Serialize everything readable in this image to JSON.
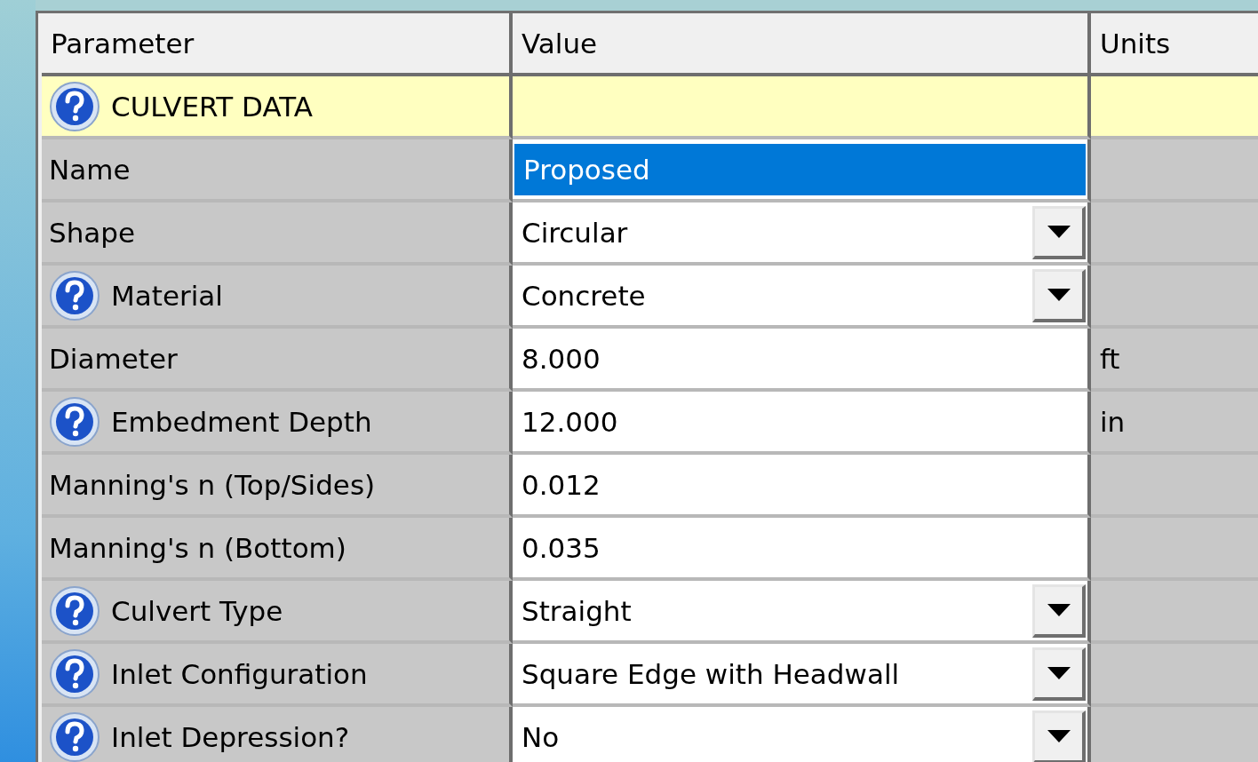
{
  "columns": [
    "Parameter",
    "Value",
    "Units"
  ],
  "rows": [
    {
      "kind": "section",
      "label": "CULVERT DATA",
      "help": true
    },
    {
      "kind": "text",
      "label": "Name",
      "help": false,
      "value": "Proposed",
      "selected": true
    },
    {
      "kind": "dropdown",
      "label": "Shape",
      "help": false,
      "value": "Circular",
      "selected": false
    },
    {
      "kind": "dropdown",
      "label": "Material",
      "help": true,
      "value": "Concrete",
      "selected": false
    },
    {
      "kind": "text",
      "label": "Diameter",
      "help": false,
      "value": "8.000",
      "units": "ft",
      "selected": false
    },
    {
      "kind": "text",
      "label": "Embedment Depth",
      "help": true,
      "value": "12.000",
      "units": "in",
      "selected": false
    },
    {
      "kind": "text",
      "label": "Manning's n (Top/Sides)",
      "help": false,
      "value": "0.012",
      "selected": false
    },
    {
      "kind": "text",
      "label": "Manning's n (Bottom)",
      "help": false,
      "value": "0.035",
      "selected": false
    },
    {
      "kind": "dropdown",
      "label": "Culvert Type",
      "help": true,
      "value": "Straight",
      "selected": false
    },
    {
      "kind": "dropdown",
      "label": "Inlet Configuration",
      "help": true,
      "value": "Square Edge with Headwall",
      "selected": false
    },
    {
      "kind": "dropdown",
      "label": "Inlet Depression?",
      "help": true,
      "value": "No",
      "selected": false
    }
  ]
}
